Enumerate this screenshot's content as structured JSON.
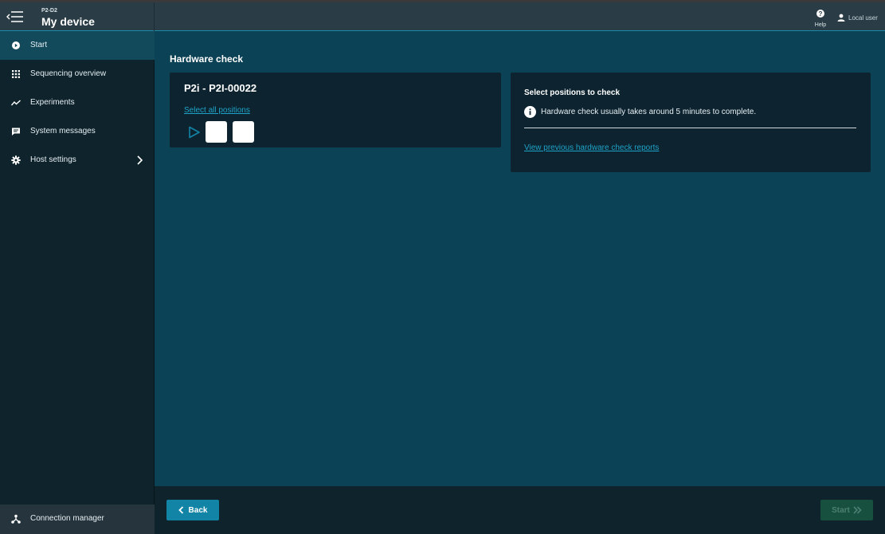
{
  "header": {
    "device_id": "P2-D2",
    "device_name": "My device",
    "help_label": "Help",
    "user_label": "Local user"
  },
  "sidebar": {
    "items": [
      {
        "label": "Start",
        "icon": "play-circle-icon",
        "active": true
      },
      {
        "label": "Sequencing overview",
        "icon": "grid-icon"
      },
      {
        "label": "Experiments",
        "icon": "trend-line-icon"
      },
      {
        "label": "System messages",
        "icon": "message-icon"
      },
      {
        "label": "Host settings",
        "icon": "gear-icon"
      }
    ],
    "connection_manager": "Connection manager"
  },
  "main": {
    "title": "Hardware check",
    "device_card": {
      "title": "P2i - P2I-00022",
      "select_all": "Select all positions"
    },
    "info_card": {
      "title": "Select positions to check",
      "info_text": "Hardware check usually takes around 5 minutes to complete.",
      "reports_link": "View previous hardware check reports"
    }
  },
  "footer": {
    "back_label": "Back",
    "start_label": "Start"
  },
  "colors": {
    "accent": "#1284a6",
    "link": "#1ea3c8",
    "main_bg": "#0c4255",
    "card_bg": "#0d2430",
    "sidebar_bg": "#0e232c",
    "start_disabled": "#18503f"
  }
}
